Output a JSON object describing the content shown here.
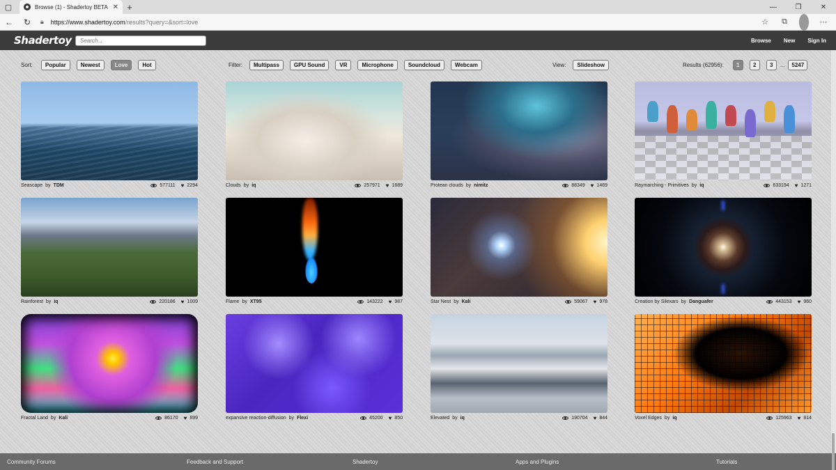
{
  "browser": {
    "tab_title": "Browse (1) - Shadertoy BETA",
    "url_host": "https://www.shadertoy.com",
    "url_path": "/results?query=&sort=love"
  },
  "header": {
    "logo": "Shadertoy",
    "search_placeholder": "Search...",
    "nav": [
      "Browse",
      "New",
      "Sign In"
    ]
  },
  "controls": {
    "sort_label": "Sort:",
    "sort_options": [
      "Popular",
      "Newest",
      "Love",
      "Hot"
    ],
    "sort_active": "Love",
    "filter_label": "Filter:",
    "filters": [
      "Multipass",
      "GPU Sound",
      "VR",
      "Microphone",
      "Soundcloud",
      "Webcam"
    ],
    "view_label": "View:",
    "view_option": "Slideshow",
    "results_label": "Results (62956):",
    "pages": [
      "1",
      "2",
      "3"
    ],
    "ellipsis": "...",
    "last_page": "5247"
  },
  "by_label": "by",
  "shaders": [
    {
      "title": "Seascape",
      "author": "TDM",
      "views": "577111",
      "likes": "2294"
    },
    {
      "title": "Clouds",
      "author": "iq",
      "views": "257971",
      "likes": "1689"
    },
    {
      "title": "Protean clouds",
      "author": "nimitz",
      "views": "88349",
      "likes": "1469"
    },
    {
      "title": "Raymarching - Primitives",
      "author": "iq",
      "views": "633194",
      "likes": "1271"
    },
    {
      "title": "Rainforest",
      "author": "iq",
      "views": "220186",
      "likes": "1009"
    },
    {
      "title": "Flame",
      "author": "XT95",
      "views": "143222",
      "likes": "987"
    },
    {
      "title": "Star Nest",
      "author": "Kali",
      "views": "59067",
      "likes": "978"
    },
    {
      "title": "Creation by Silexars",
      "author": "Danguafer",
      "views": "443153",
      "likes": "960"
    },
    {
      "title": "Fractal Land",
      "author": "Kali",
      "views": "86170",
      "likes": "899"
    },
    {
      "title": "expansive reaction-diffusion",
      "author": "Flexi",
      "views": "45200",
      "likes": "850"
    },
    {
      "title": "Elevated",
      "author": "iq",
      "views": "190704",
      "likes": "844"
    },
    {
      "title": "Voxel Edges",
      "author": "iq",
      "views": "125963",
      "likes": "814"
    }
  ],
  "footer": [
    "Community Forums",
    "Feedback and Support",
    "Shadertoy",
    "Apps and Plugins",
    "Tutorials"
  ]
}
